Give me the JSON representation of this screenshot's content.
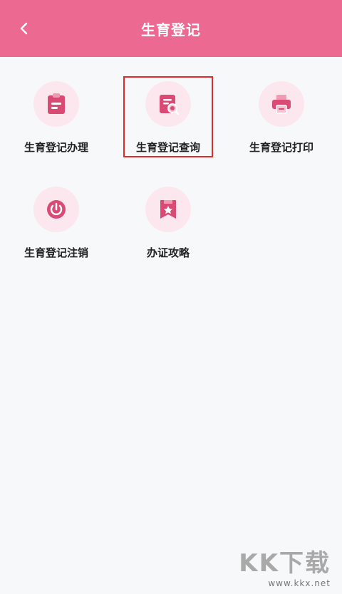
{
  "header": {
    "title": "生育登记"
  },
  "menu": [
    {
      "label": "生育登记办理",
      "icon": "clipboard-icon"
    },
    {
      "label": "生育登记查询",
      "icon": "document-search-icon"
    },
    {
      "label": "生育登记打印",
      "icon": "printer-icon"
    },
    {
      "label": "生育登记注销",
      "icon": "power-icon"
    },
    {
      "label": "办证攻略",
      "icon": "star-bookmark-icon"
    }
  ],
  "watermark": {
    "main": "KK下载",
    "url": "www.kkx.net"
  },
  "colors": {
    "header": "#ec6a91",
    "icon_fill": "#d94a75",
    "icon_bg": "#fde7ee",
    "highlight": "#e02b2b"
  }
}
